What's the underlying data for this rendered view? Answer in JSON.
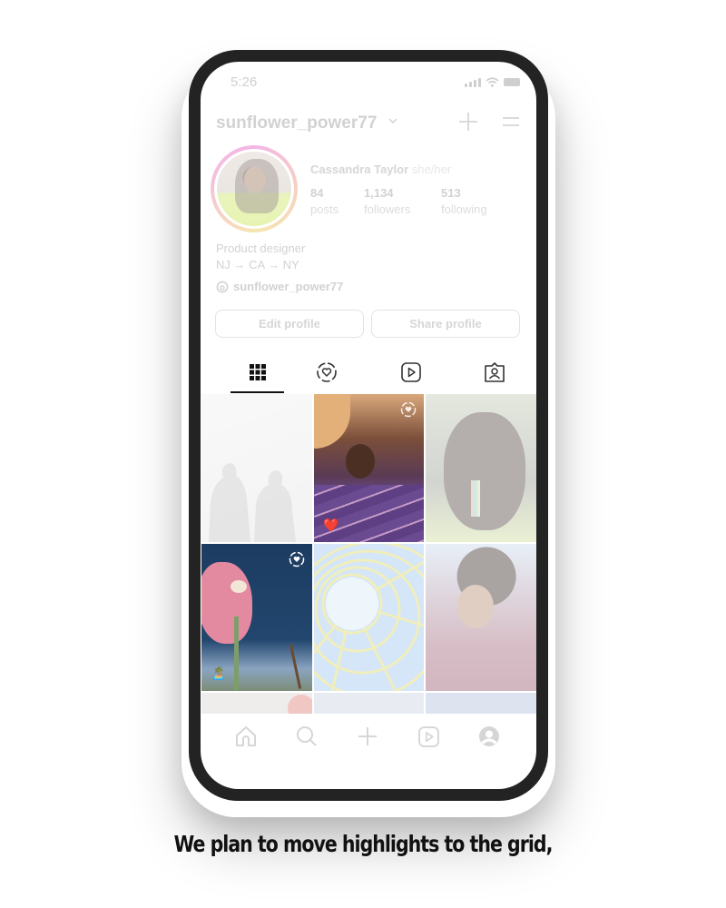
{
  "status_bar": {
    "time": "5:26",
    "icons": [
      "signal-icon",
      "wifi-icon",
      "battery-icon"
    ]
  },
  "header": {
    "username": "sunflower_power77",
    "icons": [
      "chevron-down-icon",
      "plus-icon",
      "menu-icon"
    ]
  },
  "profile": {
    "display_name": "Cassandra Taylor",
    "pronouns": "she/her",
    "stats": [
      {
        "value": "84",
        "label": "posts"
      },
      {
        "value": "1,134",
        "label": "followers"
      },
      {
        "value": "513",
        "label": "following"
      }
    ],
    "bio_lines": [
      "Product designer",
      "NJ → CA → NY"
    ],
    "threads_handle": "sunflower_power77"
  },
  "buttons": {
    "edit": "Edit profile",
    "share": "Share profile"
  },
  "tabs": [
    {
      "name": "grid",
      "icon": "grid-icon",
      "active": true
    },
    {
      "name": "highlights",
      "icon": "highlight-heart-icon",
      "active": false
    },
    {
      "name": "reels",
      "icon": "reels-icon",
      "active": false
    },
    {
      "name": "tagged",
      "icon": "tagged-person-icon",
      "active": false
    }
  ],
  "grid": {
    "tiles": [
      {
        "subject": "shadows of two people",
        "faded": true,
        "badge": ""
      },
      {
        "subject": "friends selfie from below",
        "faded": false,
        "badge": "highlight-heart-icon",
        "sticker": "❤️"
      },
      {
        "subject": "woman with earring profile",
        "faded": true,
        "badge": ""
      },
      {
        "subject": "pink flower against sky",
        "faded": false,
        "badge": "highlight-heart-icon",
        "sticker": "🏝️"
      },
      {
        "subject": "yellow spiral structure",
        "faded": true,
        "badge": ""
      },
      {
        "subject": "smiling woman with curly hair",
        "faded": true,
        "badge": ""
      }
    ]
  },
  "bottom_nav": [
    "home-icon",
    "search-icon",
    "create-icon",
    "reels-icon",
    "profile-icon"
  ],
  "caption": "We plan to move highlights to the grid,"
}
